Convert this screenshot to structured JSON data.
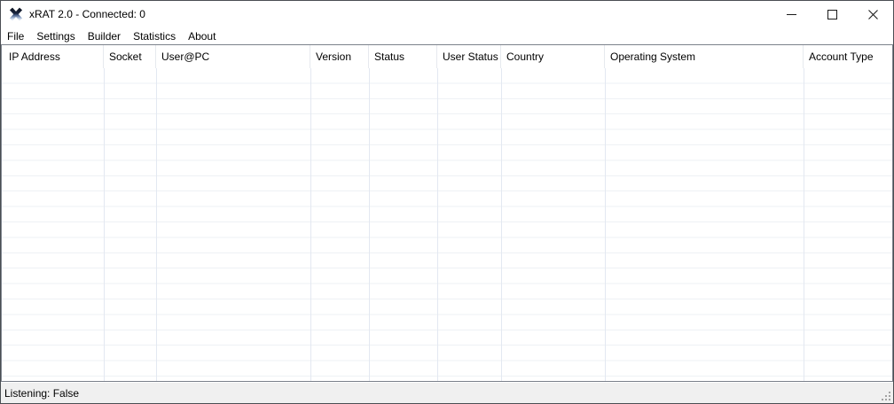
{
  "window": {
    "title": "xRAT 2.0 - Connected: 0",
    "app_icon": "xrat-x-logo-icon",
    "border_color": "#4a4e53"
  },
  "titlebar": {
    "buttons": [
      {
        "name": "minimize",
        "icon": "minimize-icon"
      },
      {
        "name": "maximize",
        "icon": "maximize-icon"
      },
      {
        "name": "close",
        "icon": "close-icon"
      }
    ]
  },
  "menu": {
    "items": [
      {
        "label": "File"
      },
      {
        "label": "Settings"
      },
      {
        "label": "Builder"
      },
      {
        "label": "Statistics"
      },
      {
        "label": "About"
      }
    ]
  },
  "listview": {
    "columns": [
      {
        "label": "IP Address"
      },
      {
        "label": "Socket"
      },
      {
        "label": "User@PC"
      },
      {
        "label": "Version"
      },
      {
        "label": "Status"
      },
      {
        "label": "User Status"
      },
      {
        "label": "Country"
      },
      {
        "label": "Operating System"
      },
      {
        "label": "Account Type"
      }
    ],
    "rows": [],
    "grid_line_vertical_color": "#e3e8f1",
    "grid_line_horizontal_color": "#eef1f5",
    "border_color": "#7b818b"
  },
  "statusbar": {
    "text": "Listening: False",
    "background": "#f0f0f0",
    "grip_icon": "resize-grip-icon",
    "grip_dot_color": "#a3a3a3"
  },
  "icon_colors": {
    "logo_top": "#0d1422",
    "logo_mid": "#1c2844",
    "logo_bottom": "#cfdbec"
  }
}
